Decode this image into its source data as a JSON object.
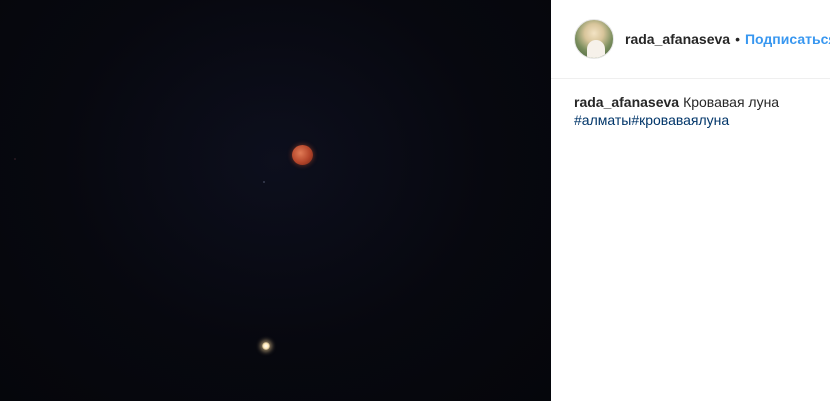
{
  "post": {
    "username": "rada_afanaseva",
    "separator": "•",
    "follow_label": "Подписаться",
    "caption_username": "rada_afanaseva",
    "caption_text": "Кровавая луна",
    "hashtags": "#алматы#кроваваялуна"
  },
  "colors": {
    "accent": "#3897f0",
    "hashtag": "#003569",
    "text": "#262626"
  }
}
